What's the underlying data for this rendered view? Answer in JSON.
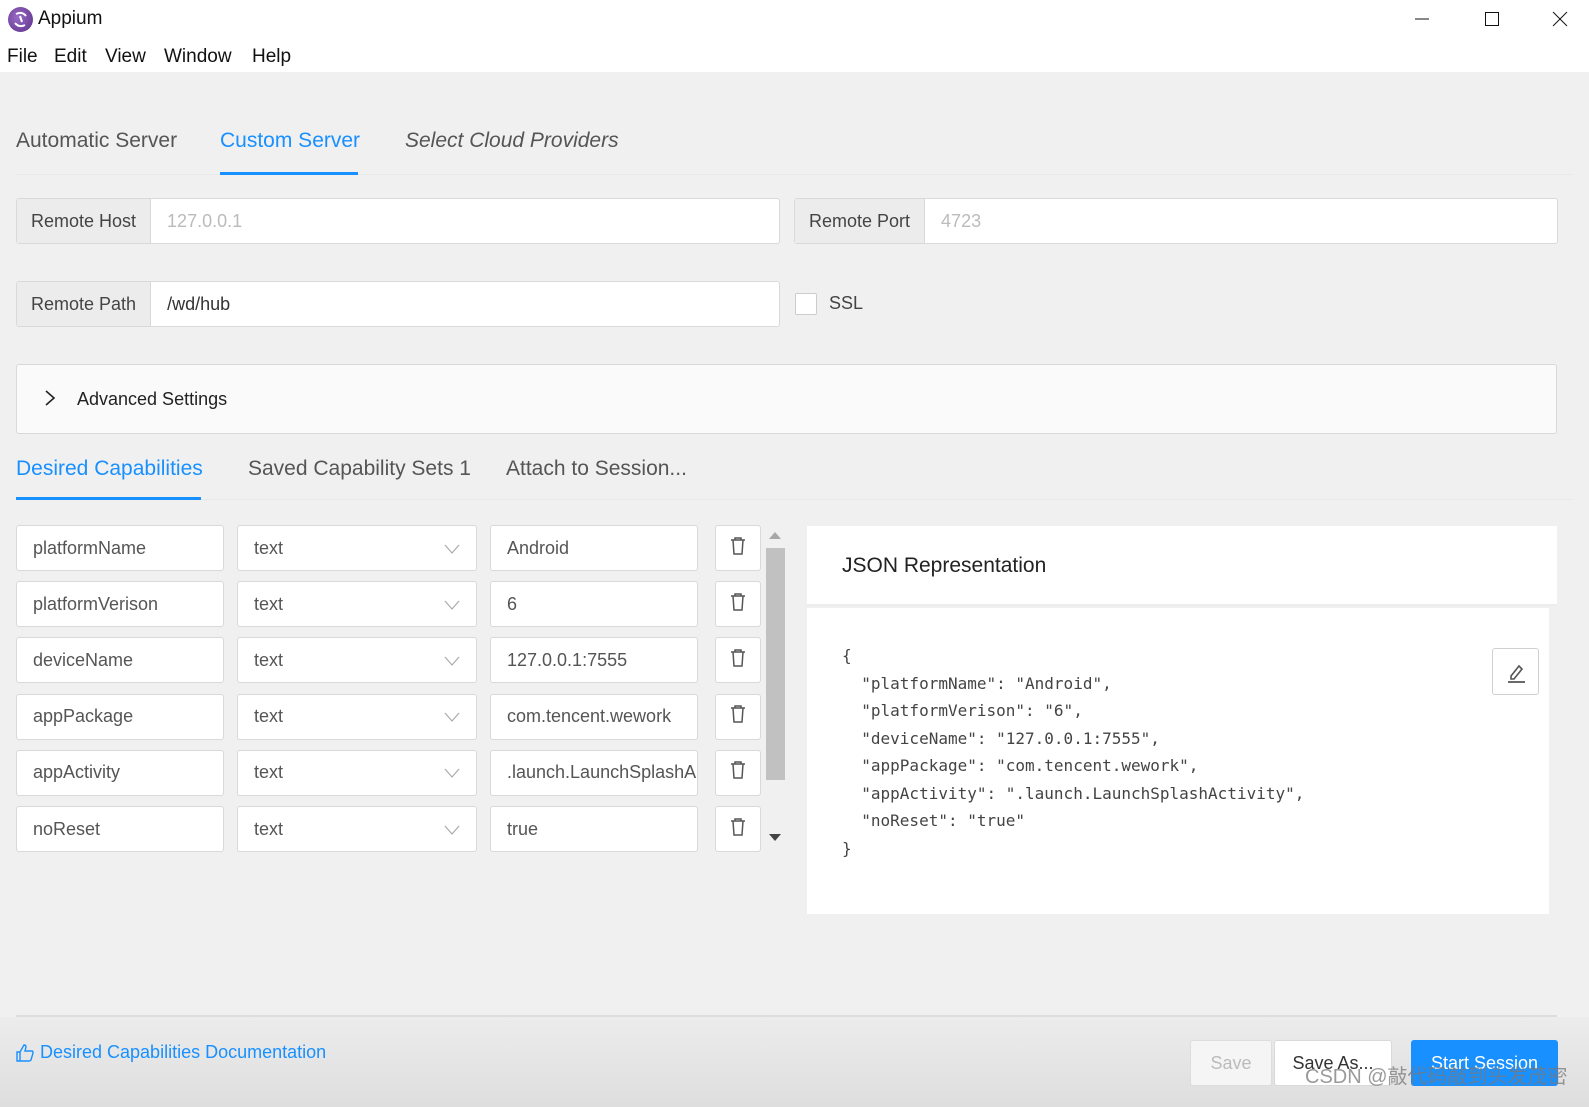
{
  "window": {
    "title": "Appium",
    "logo_icon": "appium-logo-icon",
    "controls": [
      "minimize",
      "maximize",
      "close"
    ]
  },
  "menu": [
    "File",
    "Edit",
    "View",
    "Window",
    "Help"
  ],
  "server_tabs": [
    {
      "label": "Automatic Server",
      "active": false
    },
    {
      "label": "Custom Server",
      "active": true
    },
    {
      "label": "Select Cloud Providers",
      "active": false
    }
  ],
  "server": {
    "remote_host": {
      "label": "Remote Host",
      "placeholder": "127.0.0.1",
      "value": ""
    },
    "remote_port": {
      "label": "Remote Port",
      "placeholder": "4723",
      "value": ""
    },
    "remote_path": {
      "label": "Remote Path",
      "value": "/wd/hub"
    },
    "ssl": {
      "label": "SSL",
      "checked": false
    }
  },
  "advanced": {
    "label": "Advanced Settings",
    "expanded": false
  },
  "capability_tabs": [
    {
      "label": "Desired Capabilities",
      "active": true
    },
    {
      "label": "Saved Capability Sets 1",
      "active": false
    },
    {
      "label": "Attach to Session...",
      "active": false
    }
  ],
  "capabilities": [
    {
      "name": "platformName",
      "type": "text",
      "value": "Android"
    },
    {
      "name": "platformVerison",
      "type": "text",
      "value": "6"
    },
    {
      "name": "deviceName",
      "type": "text",
      "value": "127.0.0.1:7555"
    },
    {
      "name": "appPackage",
      "type": "text",
      "value": "com.tencent.wework"
    },
    {
      "name": "appActivity",
      "type": "text",
      "value": ".launch.LaunchSplashA"
    },
    {
      "name": "noReset",
      "type": "text",
      "value": "true"
    }
  ],
  "json_panel": {
    "title": "JSON Representation",
    "code": "{\n  \"platformName\": \"Android\",\n  \"platformVerison\": \"6\",\n  \"deviceName\": \"127.0.0.1:7555\",\n  \"appPackage\": \"com.tencent.wework\",\n  \"appActivity\": \".launch.LaunchSplashActivity\",\n  \"noReset\": \"true\"\n}"
  },
  "footer": {
    "doc_link": "Desired Capabilities Documentation",
    "save": "Save",
    "save_as": "Save As...",
    "start_session": "Start Session"
  },
  "watermark": "CSDN @敲代码敲到头发茂密",
  "colors": {
    "accent": "#1890ff",
    "background": "#f0f0f0"
  }
}
